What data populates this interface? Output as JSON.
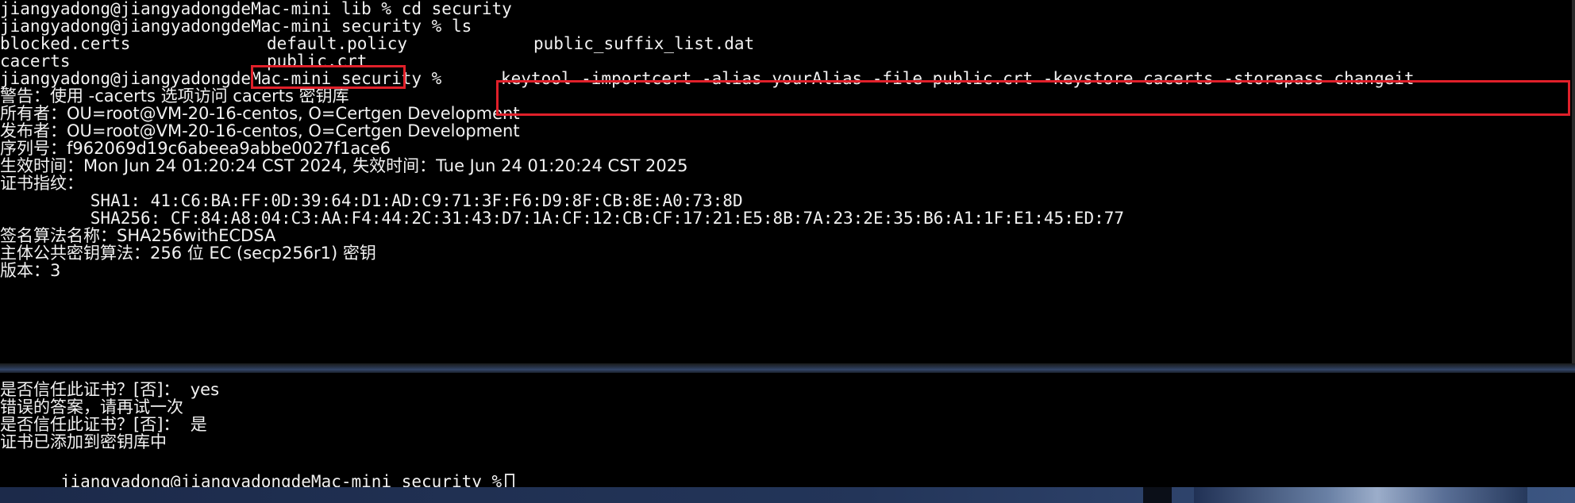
{
  "terminal": {
    "prompt": "jiangyadong@jiangyadongdeMac-mini security %",
    "lines": {
      "l1": "jiangyadong@jiangyadongdeMac-mini lib % cd security",
      "l2": "jiangyadong@jiangyadongdeMac-mini security % ls",
      "warning": "警告：使用 -cacerts 选项访问 cacerts 密钥库",
      "owner": "所有者：OU=root@VM-20-16-centos, O=Certgen Development",
      "issuer": "发布者：OU=root@VM-20-16-centos, O=Certgen Development",
      "serial": "序列号：f962069d19c6abeea9abbe0027f1ace6",
      "validity": "生效时间：Mon Jun 24 01:20:24 CST 2024, 失效时间：Tue Jun 24 01:20:24 CST 2025",
      "fingerprints": "证书指纹：",
      "sha1": "         SHA1: 41:C6:BA:FF:0D:39:64:D1:AD:C9:71:3F:F6:D9:8F:CB:8E:A0:73:8D",
      "sha256": "         SHA256: CF:84:A8:04:C3:AA:F4:44:2C:31:43:D7:1A:CF:12:CB:CF:17:21:E5:8B:7A:23:2E:35:B6:A1:1F:E1:45:ED:77",
      "sigalg": "签名算法名称：SHA256withECDSA",
      "keyalg": "主体公共密钥算法：256 位 EC (secp256r1) 密钥",
      "version": "版本：3"
    },
    "ls_files": {
      "row1": [
        "blocked.certs",
        "default.policy",
        "public_suffix_list.dat"
      ],
      "row2": [
        "cacerts",
        "public.crt"
      ]
    },
    "command": "keytool -importcert -alias yourAlias -file public.crt -keystore cacerts -storepass changeit",
    "bottom": {
      "trust_q1": "是否信任此证书？[否]：  yes",
      "wrong_answer": "错误的答案，请再试一次",
      "trust_q2": "是否信任此证书？[否]：  是",
      "added": "证书已添加到密钥库中",
      "final_prompt": "jiangyadong@jiangyadongdeMac-mini security %"
    }
  },
  "colors": {
    "text": "#f2f2f2",
    "background": "#000000",
    "highlight_border": "#e0202a"
  }
}
